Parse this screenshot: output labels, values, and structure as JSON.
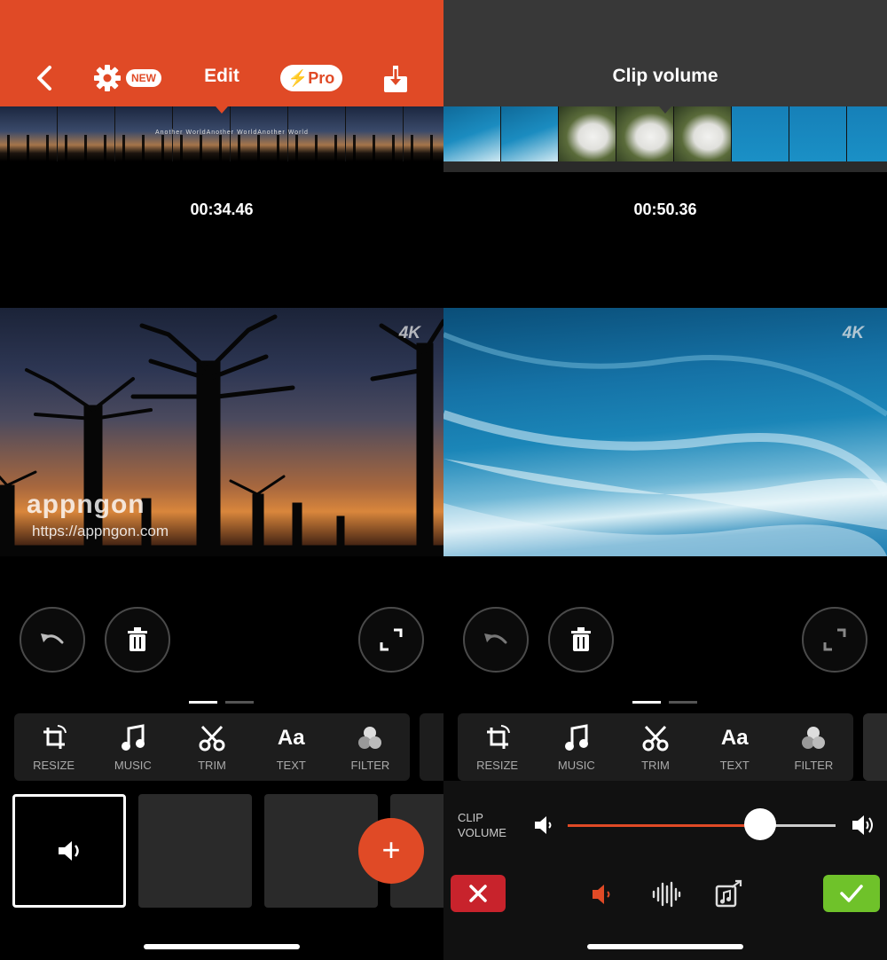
{
  "left": {
    "header": {
      "title": "Edit",
      "new_badge": "NEW",
      "pro_label": "Pro"
    },
    "filmstrip_text": "Another WorldAnother WorldAnother World",
    "timecode": "00:34.46",
    "video": {
      "quality_badge": "4K"
    },
    "watermark": {
      "brand": "appngon",
      "url": "https://appngon.com"
    },
    "tools": [
      {
        "label": "RESIZE",
        "icon": "crop-rotate-icon"
      },
      {
        "label": "MUSIC",
        "icon": "music-note-icon"
      },
      {
        "label": "TRIM",
        "icon": "scissors-icon"
      },
      {
        "label": "TEXT",
        "icon": "text-aa-icon"
      },
      {
        "label": "FILTER",
        "icon": "filter-circles-icon"
      }
    ],
    "add_button_label": "+"
  },
  "right": {
    "header": {
      "title": "Clip volume"
    },
    "timecode": "00:50.36",
    "video": {
      "quality_badge": "4K"
    },
    "tools": [
      {
        "label": "RESIZE",
        "icon": "crop-rotate-icon"
      },
      {
        "label": "MUSIC",
        "icon": "music-note-icon"
      },
      {
        "label": "TRIM",
        "icon": "scissors-icon"
      },
      {
        "label": "TEXT",
        "icon": "text-aa-icon"
      },
      {
        "label": "FILTER",
        "icon": "filter-circles-icon"
      }
    ],
    "volume": {
      "label_line1": "CLIP",
      "label_line2": "VOLUME",
      "level": 0.72
    }
  },
  "colors": {
    "accent": "#e04a26",
    "cancel": "#c8232c",
    "confirm": "#6fc22a"
  }
}
